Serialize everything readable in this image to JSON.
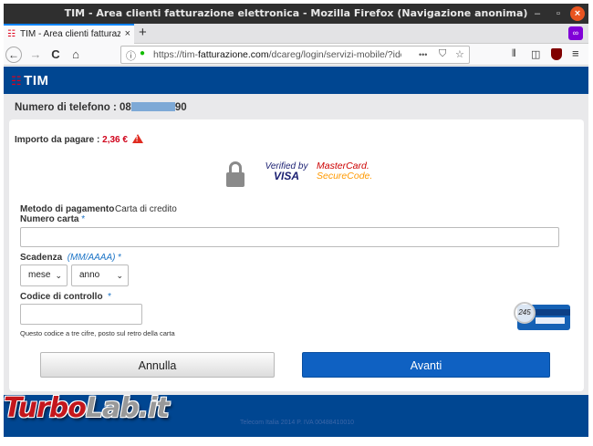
{
  "window": {
    "title": "TIM - Area clienti fatturazione elettronica - Mozilla Firefox (Navigazione anonima)",
    "minimize_glyph": "–",
    "maximize_glyph": "▫",
    "close_glyph": "×"
  },
  "tabs": [
    {
      "label": "TIM - Area clienti fatturaz",
      "close_glyph": "×"
    }
  ],
  "new_tab_glyph": "+",
  "private_glyph": "∞",
  "nav": {
    "back_glyph": "←",
    "forward_glyph": "→",
    "reload_glyph": "C",
    "home_glyph": "⌂"
  },
  "url": {
    "prefix": "https://tim-",
    "domain": "fatturazione.com",
    "path": "/dcareg/login/servizi-mobile/?ide",
    "more_glyph": "•••",
    "pocket_glyph": "⛉",
    "star_glyph": "☆"
  },
  "toolbar": {
    "library_glyph": "⫴",
    "sidebar_glyph": "◫",
    "menu_glyph": "≡"
  },
  "brand": {
    "mark": "☷",
    "name": "TIM"
  },
  "phone": {
    "label": "Numero di telefono :",
    "value_start": "08",
    "value_end": "90"
  },
  "amount": {
    "label": "Importo da pagare :",
    "value": "2,36 €"
  },
  "security": {
    "vbv_line1": "Verified by",
    "vbv_line2": "VISA",
    "mc_line1": "MasterCard.",
    "mc_line2": "SecureCode."
  },
  "form": {
    "method_label": "Metodo di pagamento",
    "method_value": "Carta di credito",
    "card_number_label": "Numero carta",
    "required_mark": "*",
    "card_number_value": "",
    "expiry_label": "Scadenza",
    "expiry_format": "(MM/AAAA)",
    "month_selected": "mese",
    "year_selected": "anno",
    "cvv_label": "Codice di controllo",
    "cvv_value": "",
    "cvv_help": "Questo codice a tre cifre, posto sul retro della carta",
    "cvv_example": "245"
  },
  "buttons": {
    "cancel": "Annulla",
    "next": "Avanti"
  },
  "footer": {
    "copyright": "Telecom Italia 2014 P. IVA 00488410010"
  },
  "watermark": {
    "part1": "Turbo",
    "part2": "Lab.it"
  },
  "colors": {
    "brand_blue": "#004691",
    "primary_button": "#0f61c2",
    "alert_red": "#d0021b"
  }
}
